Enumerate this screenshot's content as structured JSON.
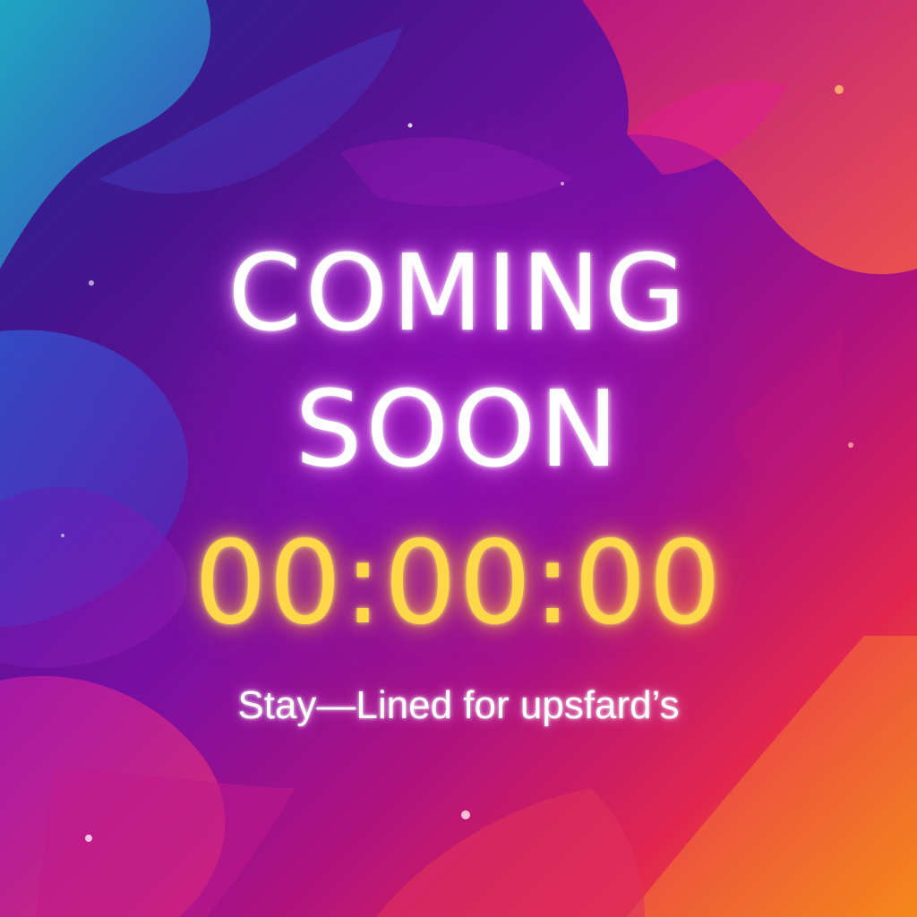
{
  "headline": {
    "line1": "COMING",
    "line2": "SOON"
  },
  "countdown": {
    "time": "00:00:00"
  },
  "tagline": "Stay—Lined for upsfard’s",
  "colors": {
    "headline_text": "#ffffff",
    "countdown_text": "#ffd84a",
    "background_top_left": "#1d2b8f",
    "background_center": "#7a0fa3",
    "background_bottom_right": "#f07a14"
  },
  "icons": [
    "sparkle-dot"
  ]
}
